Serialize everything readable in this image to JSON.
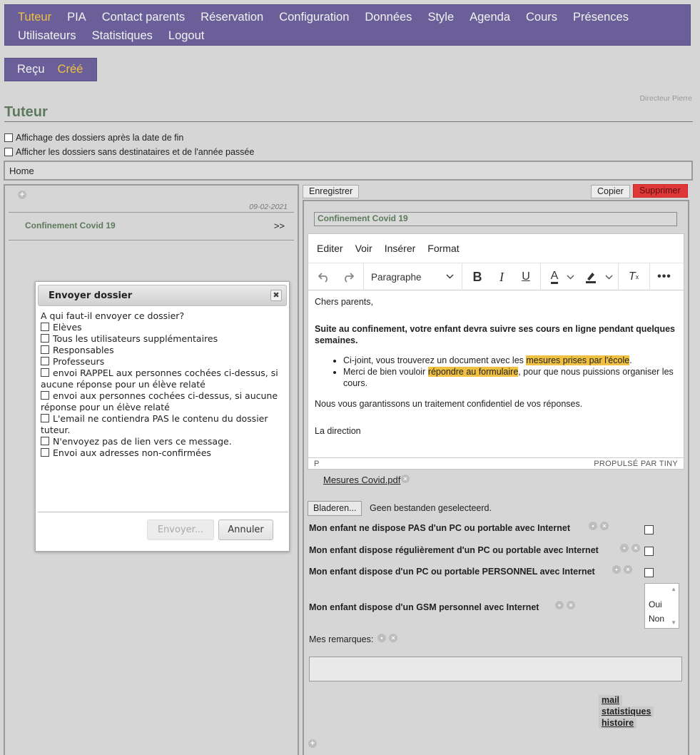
{
  "nav": {
    "row1": [
      "Tuteur",
      "PIA",
      "Contact parents",
      "Réservation",
      "Configuration",
      "Données",
      "Style",
      "Agenda",
      "Cours",
      "Présences"
    ],
    "row2": [
      "Utilisateurs",
      "Statistiques",
      "Logout"
    ],
    "active": "Tuteur",
    "accent": "#f0c040",
    "bg": "#6a5f98"
  },
  "subnav": {
    "items": [
      "Reçu",
      "Créé"
    ],
    "active": "Créé"
  },
  "user": "Directeur Pierre",
  "page_title": "Tuteur",
  "options": {
    "show_after_end": "Affichage des dossiers après la date de fin",
    "show_no_recipients": "Afficher les dossiers sans destinataires et de l'année passée"
  },
  "breadcrumb": "Home",
  "list": {
    "items": [
      {
        "date": "09-02-2021",
        "title": "Confinement Covid 19",
        "arrow": ">>"
      }
    ]
  },
  "dialog": {
    "title": "Envoyer dossier",
    "question": "A qui faut-il envoyer ce dossier?",
    "options": [
      "Elèves",
      "Tous les utilisateurs supplémentaires",
      "Responsables",
      "Professeurs",
      "envoi RAPPEL aux personnes cochées ci-dessus, si aucune réponse pour un élève relaté",
      "envoi aux personnes cochées ci-dessus, si aucune réponse pour un élève relaté",
      "L'email ne contiendra PAS le contenu du dossier tuteur.",
      "N'envoyez pas de lien vers ce message.",
      "Envoi aux adresses non-confirmées"
    ],
    "send_label": "Envoyer...",
    "cancel_label": "Annuler"
  },
  "actions": {
    "save": "Enregistrer",
    "copy": "Copier",
    "delete": "Supprimer",
    "delete_color": "#e03838"
  },
  "doc": {
    "title": "Confinement Covid 19",
    "editor": {
      "menus": [
        "Editer",
        "Voir",
        "Insérer",
        "Format"
      ],
      "block_format": "Paragraphe",
      "greeting": "Chers parents,",
      "bold_intro": "Suite au confinement, votre enfant devra suivre ses cours en ligne pendant quelques semaines.",
      "bullet1_pre": "Ci-joint, vous trouverez un document avec les ",
      "bullet1_hl": "mesures prises par l'école",
      "bullet1_post": ".",
      "bullet2_pre": "Merci de bien vouloir ",
      "bullet2_hl": "répondre au formulaire",
      "bullet2_post": ", pour que nous puissions organiser les cours.",
      "confidential": "Nous vous garantissons un traitement confidentiel de vos réponses.",
      "signature": "La direction",
      "status_path": "P",
      "powered_by": "PROPULSÉ PAR TINY"
    },
    "attachment": "Mesures Covid.pdf",
    "browse_label": "Bladeren...",
    "no_file": "Geen bestanden geselecteerd.",
    "questions": [
      "Mon enfant ne dispose PAS d'un PC ou portable avec Internet",
      "Mon enfant dispose régulièrement d'un PC ou portable avec Internet",
      "Mon enfant dispose d'un PC ou portable PERSONNEL avec Internet",
      "Mon enfant dispose d'un GSM personnel avec Internet"
    ],
    "gsm_options": [
      "Oui",
      "Non"
    ],
    "remarks_label": "Mes remarques:",
    "links": [
      "mail",
      "statistiques",
      "histoire"
    ]
  }
}
